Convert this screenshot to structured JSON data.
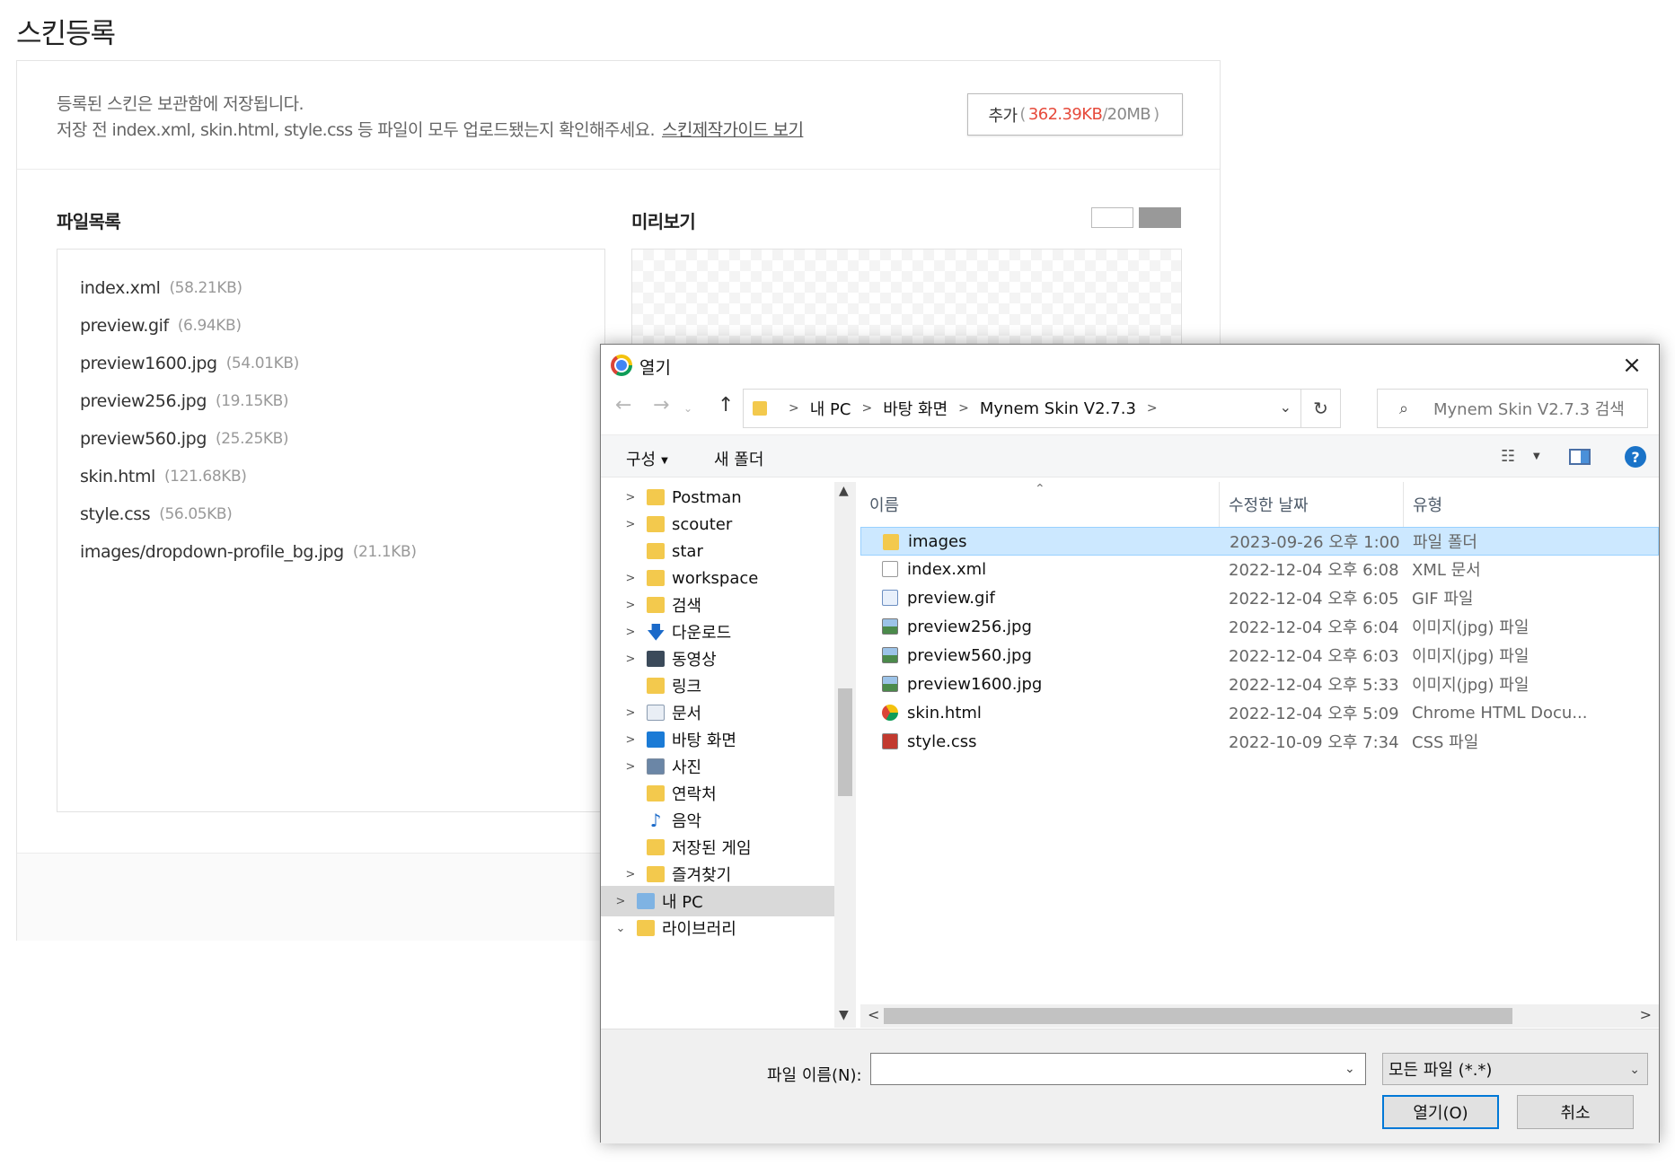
{
  "page": {
    "title": "스킨등록",
    "notice_line1": "등록된 스킨은 보관함에 저장됩니다.",
    "notice_line2": "저장 전 index.xml, skin.html, style.css 등 파일이 모두 업로드됐는지 확인해주세요.",
    "guide_link": "스킨제작가이드 보기",
    "add_button": {
      "label": "추가",
      "open_paren": "(",
      "used": "362.39KB",
      "separator": "/",
      "limit": "20MB",
      "close_paren": ")",
      "used_color": "#e64a3b"
    },
    "file_list_title": "파일목록",
    "preview_title": "미리보기",
    "files": [
      {
        "name": "index.xml",
        "size": "(58.21KB)"
      },
      {
        "name": "preview.gif",
        "size": "(6.94KB)"
      },
      {
        "name": "preview1600.jpg",
        "size": "(54.01KB)"
      },
      {
        "name": "preview256.jpg",
        "size": "(19.15KB)"
      },
      {
        "name": "preview560.jpg",
        "size": "(25.25KB)"
      },
      {
        "name": "skin.html",
        "size": "(121.68KB)"
      },
      {
        "name": "style.css",
        "size": "(56.05KB)"
      },
      {
        "name": "images/dropdown-profile_bg.jpg",
        "size": "(21.1KB)"
      }
    ]
  },
  "dialog": {
    "title": "열기",
    "close_icon": "×",
    "address": {
      "crumbs": [
        "내 PC",
        "바탕 화면",
        "Mynem Skin V2.7.3"
      ]
    },
    "search_placeholder": "Mynem Skin V2.7.3 검색",
    "toolbar": {
      "organize": "구성",
      "new_folder": "새 폴더"
    },
    "nav_items": [
      {
        "label": "Postman",
        "icon": "folder-icon",
        "expandable": true
      },
      {
        "label": "scouter",
        "icon": "folder-icon",
        "expandable": true
      },
      {
        "label": "star",
        "icon": "folder-icon",
        "expandable": false
      },
      {
        "label": "workspace",
        "icon": "folder-icon",
        "expandable": true
      },
      {
        "label": "검색",
        "icon": "search-folder-icon",
        "expandable": true
      },
      {
        "label": "다운로드",
        "icon": "download-icon",
        "expandable": true
      },
      {
        "label": "동영상",
        "icon": "video-icon",
        "expandable": true
      },
      {
        "label": "링크",
        "icon": "link-folder-icon",
        "expandable": false
      },
      {
        "label": "문서",
        "icon": "document-icon",
        "expandable": true
      },
      {
        "label": "바탕 화면",
        "icon": "desktop-icon",
        "expandable": true
      },
      {
        "label": "사진",
        "icon": "photo-icon",
        "expandable": true
      },
      {
        "label": "연락처",
        "icon": "contacts-icon",
        "expandable": false
      },
      {
        "label": "음악",
        "icon": "music-icon",
        "expandable": false
      },
      {
        "label": "저장된 게임",
        "icon": "saved-games-icon",
        "expandable": false
      },
      {
        "label": "즐겨찾기",
        "icon": "favorites-icon",
        "expandable": true
      },
      {
        "label": "내 PC",
        "icon": "computer-icon",
        "expandable": true,
        "selected": true
      },
      {
        "label": "라이브러리",
        "icon": "library-icon",
        "expandable": true,
        "expanded": true
      }
    ],
    "columns": {
      "name": "이름",
      "date": "수정한 날짜",
      "type": "유형"
    },
    "files": [
      {
        "name": "images",
        "date": "2023-09-26 오후 1:00",
        "type": "파일 폴더",
        "icon": "folder-icon",
        "selected": true
      },
      {
        "name": "index.xml",
        "date": "2022-12-04 오후 6:08",
        "type": "XML 문서",
        "icon": "xml-file-icon"
      },
      {
        "name": "preview.gif",
        "date": "2022-12-04 오후 6:05",
        "type": "GIF 파일",
        "icon": "gif-file-icon"
      },
      {
        "name": "preview256.jpg",
        "date": "2022-12-04 오후 6:04",
        "type": "이미지(jpg) 파일",
        "icon": "image-file-icon"
      },
      {
        "name": "preview560.jpg",
        "date": "2022-12-04 오후 6:03",
        "type": "이미지(jpg) 파일",
        "icon": "image-file-icon"
      },
      {
        "name": "preview1600.jpg",
        "date": "2022-12-04 오후 5:33",
        "type": "이미지(jpg) 파일",
        "icon": "image-file-icon"
      },
      {
        "name": "skin.html",
        "date": "2022-12-04 오후 5:09",
        "type": "Chrome HTML Docu...",
        "icon": "chrome-icon"
      },
      {
        "name": "style.css",
        "date": "2022-10-09 오후 7:34",
        "type": "CSS 파일",
        "icon": "css-file-icon"
      }
    ],
    "filename_label": "파일 이름(N):",
    "filename_value": "",
    "filter": "모든 파일 (*.*)",
    "open_button": "열기(O)",
    "cancel_button": "취소"
  }
}
